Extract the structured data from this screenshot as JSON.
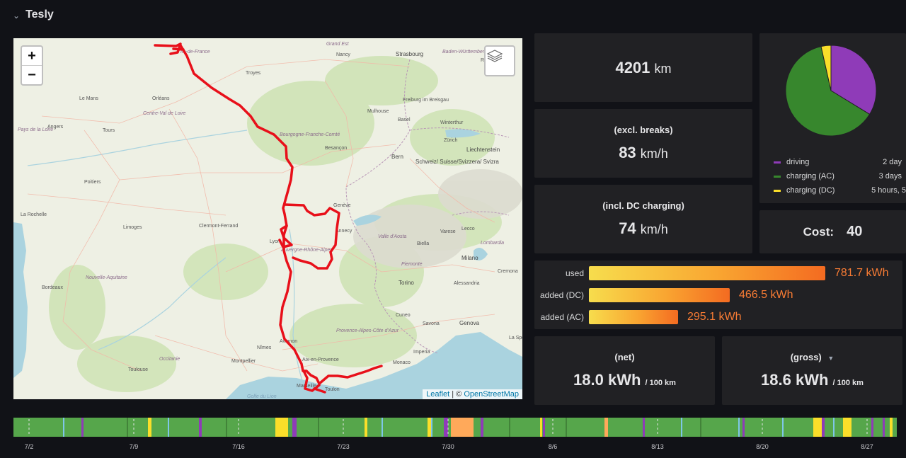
{
  "row": {
    "title": "Tesly"
  },
  "map": {
    "zoom_in": "+",
    "zoom_out": "−",
    "attribution_leaflet": "Leaflet",
    "attribution_sep": " | © ",
    "attribution_osm": "OpenStreetMap",
    "labels": [
      {
        "text": "Grand Est",
        "cls": "region"
      },
      {
        "text": "Nancy",
        "cls": ""
      },
      {
        "text": "Strasbourg",
        "cls": "big"
      },
      {
        "text": "Baden-Württemberg",
        "cls": "region"
      },
      {
        "text": "Reutlingen",
        "cls": ""
      },
      {
        "text": "Troyes",
        "cls": ""
      },
      {
        "text": "Le Mans",
        "cls": ""
      },
      {
        "text": "Orléans",
        "cls": ""
      },
      {
        "text": "Centre-Val de Loire",
        "cls": "region"
      },
      {
        "text": "Angers",
        "cls": ""
      },
      {
        "text": "Tours",
        "cls": ""
      },
      {
        "text": "Pays de la Loire",
        "cls": "region"
      },
      {
        "text": "Mulhouse",
        "cls": ""
      },
      {
        "text": "Freiburg im Breisgau",
        "cls": ""
      },
      {
        "text": "Basel",
        "cls": ""
      },
      {
        "text": "Winterthur",
        "cls": ""
      },
      {
        "text": "Zürich",
        "cls": ""
      },
      {
        "text": "Liechtenstein",
        "cls": "big"
      },
      {
        "text": "Bourgogne-Franche-Comté",
        "cls": "region"
      },
      {
        "text": "Besançon",
        "cls": ""
      },
      {
        "text": "Bern",
        "cls": "big"
      },
      {
        "text": "Schweiz/ Suisse/Svizzera/ Svizra",
        "cls": "big"
      },
      {
        "text": "Poitiers",
        "cls": ""
      },
      {
        "text": "Genève",
        "cls": ""
      },
      {
        "text": "La Rochelle",
        "cls": ""
      },
      {
        "text": "Limoges",
        "cls": ""
      },
      {
        "text": "Clermont-Ferrand",
        "cls": ""
      },
      {
        "text": "Lyon",
        "cls": ""
      },
      {
        "text": "Auvergne-Rhône-Alpes",
        "cls": "region"
      },
      {
        "text": "Annecy",
        "cls": ""
      },
      {
        "text": "Valle d'Aosta",
        "cls": "region"
      },
      {
        "text": "Varese",
        "cls": ""
      },
      {
        "text": "Lecco",
        "cls": ""
      },
      {
        "text": "Milano",
        "cls": "big"
      },
      {
        "text": "Biella",
        "cls": ""
      },
      {
        "text": "Lombardia",
        "cls": "region"
      },
      {
        "text": "Nouvelle-Aquitaine",
        "cls": "region"
      },
      {
        "text": "Bordeaux",
        "cls": ""
      },
      {
        "text": "Piemonte",
        "cls": "region"
      },
      {
        "text": "Torino",
        "cls": "big"
      },
      {
        "text": "Cremona",
        "cls": ""
      },
      {
        "text": "Alessandria",
        "cls": ""
      },
      {
        "text": "Cuneo",
        "cls": ""
      },
      {
        "text": "Provence-Alpes-Côte d'Azur",
        "cls": "region"
      },
      {
        "text": "Genova",
        "cls": "big"
      },
      {
        "text": "Savona",
        "cls": ""
      },
      {
        "text": "Avignon",
        "cls": ""
      },
      {
        "text": "Nîmes",
        "cls": ""
      },
      {
        "text": "Montpellier",
        "cls": ""
      },
      {
        "text": "Occitanie",
        "cls": "region"
      },
      {
        "text": "Toulouse",
        "cls": ""
      },
      {
        "text": "Aix-en-Provence",
        "cls": ""
      },
      {
        "text": "Monaco",
        "cls": ""
      },
      {
        "text": "Imperia",
        "cls": ""
      },
      {
        "text": "Marseille",
        "cls": ""
      },
      {
        "text": "Toulon",
        "cls": ""
      },
      {
        "text": "La Spezia",
        "cls": ""
      },
      {
        "text": "Île-de-France",
        "cls": "region"
      },
      {
        "text": "Golfe du Lion",
        "cls": "sea"
      }
    ]
  },
  "stats": {
    "distance": {
      "value": "4201",
      "unit": "km"
    },
    "excl_breaks": {
      "title": "(excl. breaks)",
      "value": "83",
      "unit": "km/h"
    },
    "incl_dc": {
      "title": "(incl. DC charging)",
      "value": "74",
      "unit": "km/h"
    },
    "cost": {
      "label": "Cost:",
      "value": "40"
    },
    "net": {
      "title": "(net)",
      "value": "18.0 kWh",
      "unit": "/ 100 km"
    },
    "gross": {
      "title": "(gross)",
      "value": "18.6 kWh",
      "unit": "/ 100 km"
    }
  },
  "pie": {
    "colors": {
      "driving": "#8f3bb8",
      "charging_ac": "#37872d",
      "charging_dc": "#fade2a"
    },
    "legend": [
      {
        "label": "driving",
        "value": "2 day"
      },
      {
        "label": "charging (AC)",
        "value": "3 days"
      },
      {
        "label": "charging (DC)",
        "value": "5 hours, 5"
      }
    ]
  },
  "energy": {
    "rows": [
      {
        "label": "used",
        "value": "781.7 kWh",
        "fraction": 1.0
      },
      {
        "label": "added (DC)",
        "value": "466.5 kWh",
        "fraction": 0.597
      },
      {
        "label": "added (AC)",
        "value": "295.1 kWh",
        "fraction": 0.378
      }
    ]
  },
  "timeline": {
    "ticks": [
      "7/2",
      "7/9",
      "7/16",
      "7/23",
      "7/30",
      "8/6",
      "8/13",
      "8/20",
      "8/27"
    ]
  }
}
